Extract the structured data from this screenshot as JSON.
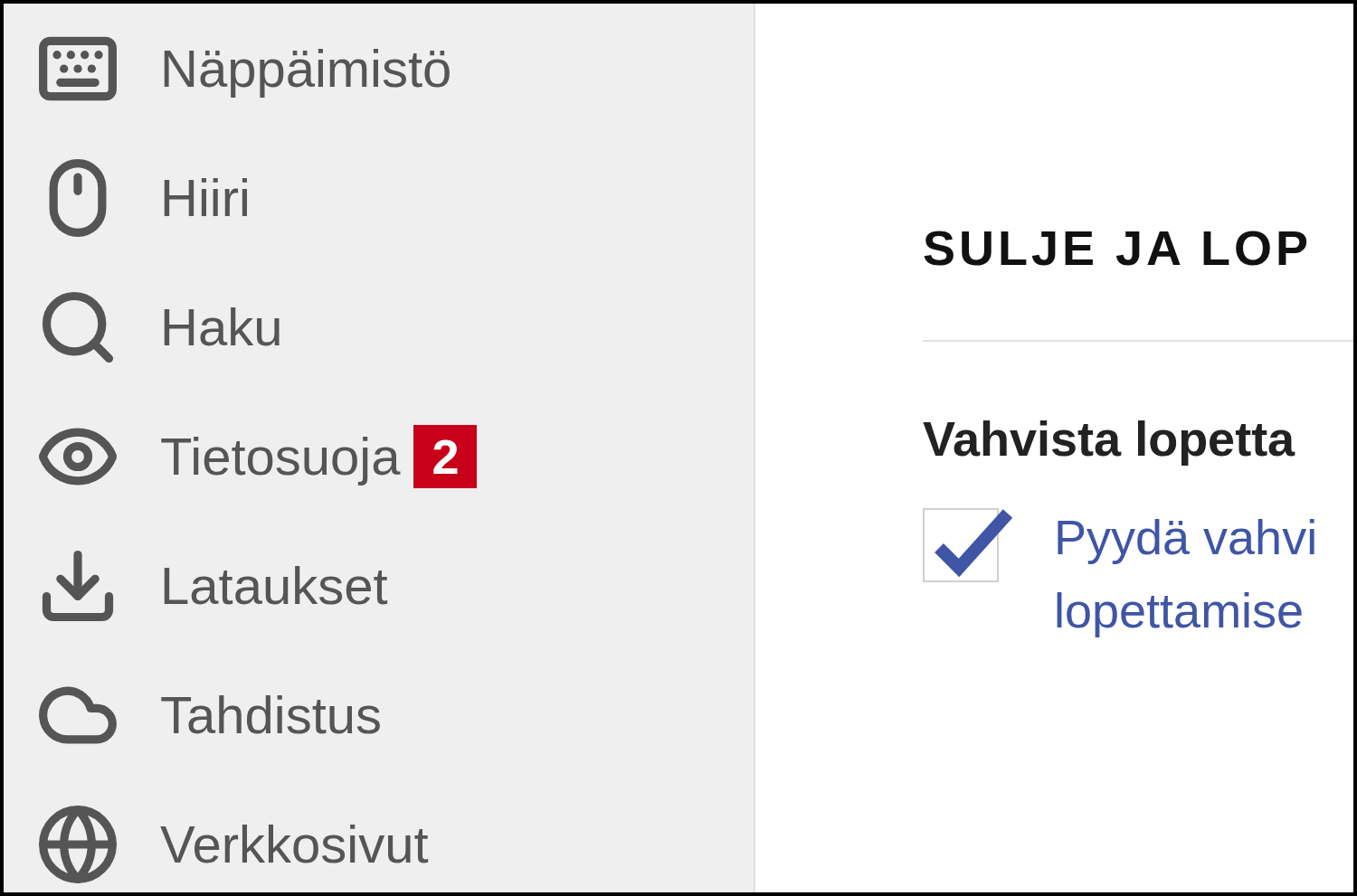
{
  "sidebar": {
    "items": [
      {
        "label": "Näppäimistö"
      },
      {
        "label": "Hiiri"
      },
      {
        "label": "Haku"
      },
      {
        "label": "Tietosuoja",
        "badge": "2"
      },
      {
        "label": "Lataukset"
      },
      {
        "label": "Tahdistus"
      },
      {
        "label": "Verkkosivut"
      }
    ]
  },
  "content": {
    "heading": "SULJE JA LOP",
    "section": "Vahvista lopetta",
    "options": [
      {
        "kind": "checkbox",
        "checked": true,
        "lines": [
          "Pyydä vahvi",
          "lopettamise"
        ]
      }
    ]
  }
}
